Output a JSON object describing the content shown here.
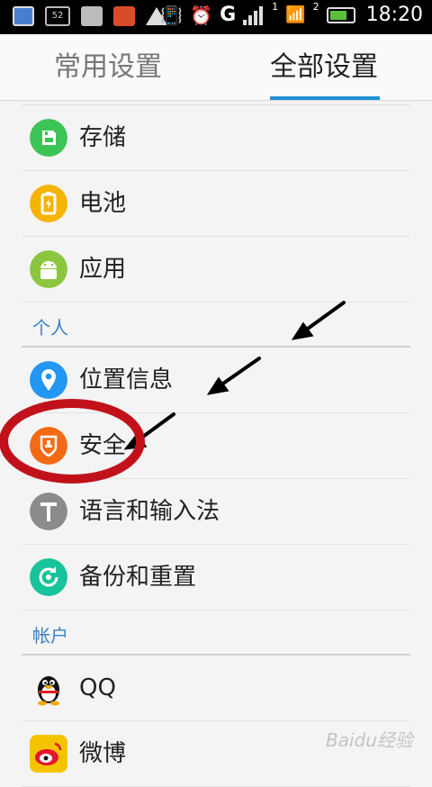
{
  "status_bar": {
    "notif_badge": "52",
    "network": "G",
    "sim1": "1",
    "sim2": "2",
    "time": "18:20"
  },
  "tabs": [
    {
      "label": "常用设置",
      "selected": false
    },
    {
      "label": "全部设置",
      "selected": true
    }
  ],
  "settings": {
    "device_items": [
      {
        "label": "存储",
        "icon": "storage-icon",
        "color": "#3cc455"
      },
      {
        "label": "电池",
        "icon": "battery-icon",
        "color": "#f5b400"
      },
      {
        "label": "应用",
        "icon": "android-icon",
        "color": "#8cc63e"
      }
    ],
    "personal_header": "个人",
    "personal_items": [
      {
        "label": "位置信息",
        "icon": "location-icon",
        "color": "#2196f3"
      },
      {
        "label": "安全",
        "icon": "shield-icon",
        "color": "#f46a14"
      },
      {
        "label": "语言和输入法",
        "icon": "language-icon",
        "color": "#8b8b8b"
      },
      {
        "label": "备份和重置",
        "icon": "backup-icon",
        "color": "#17c39a"
      }
    ],
    "accounts_header": "帐户",
    "account_items": [
      {
        "label": "QQ",
        "icon": "qq-penguin-icon"
      },
      {
        "label": "微博",
        "icon": "weibo-icon"
      }
    ]
  },
  "watermark": "Baidu经验",
  "colors": {
    "accent": "#1f8fd8",
    "section_header": "#3a80c8",
    "annotation_circle": "#c1121b",
    "annotation_arrows": "#000000"
  }
}
